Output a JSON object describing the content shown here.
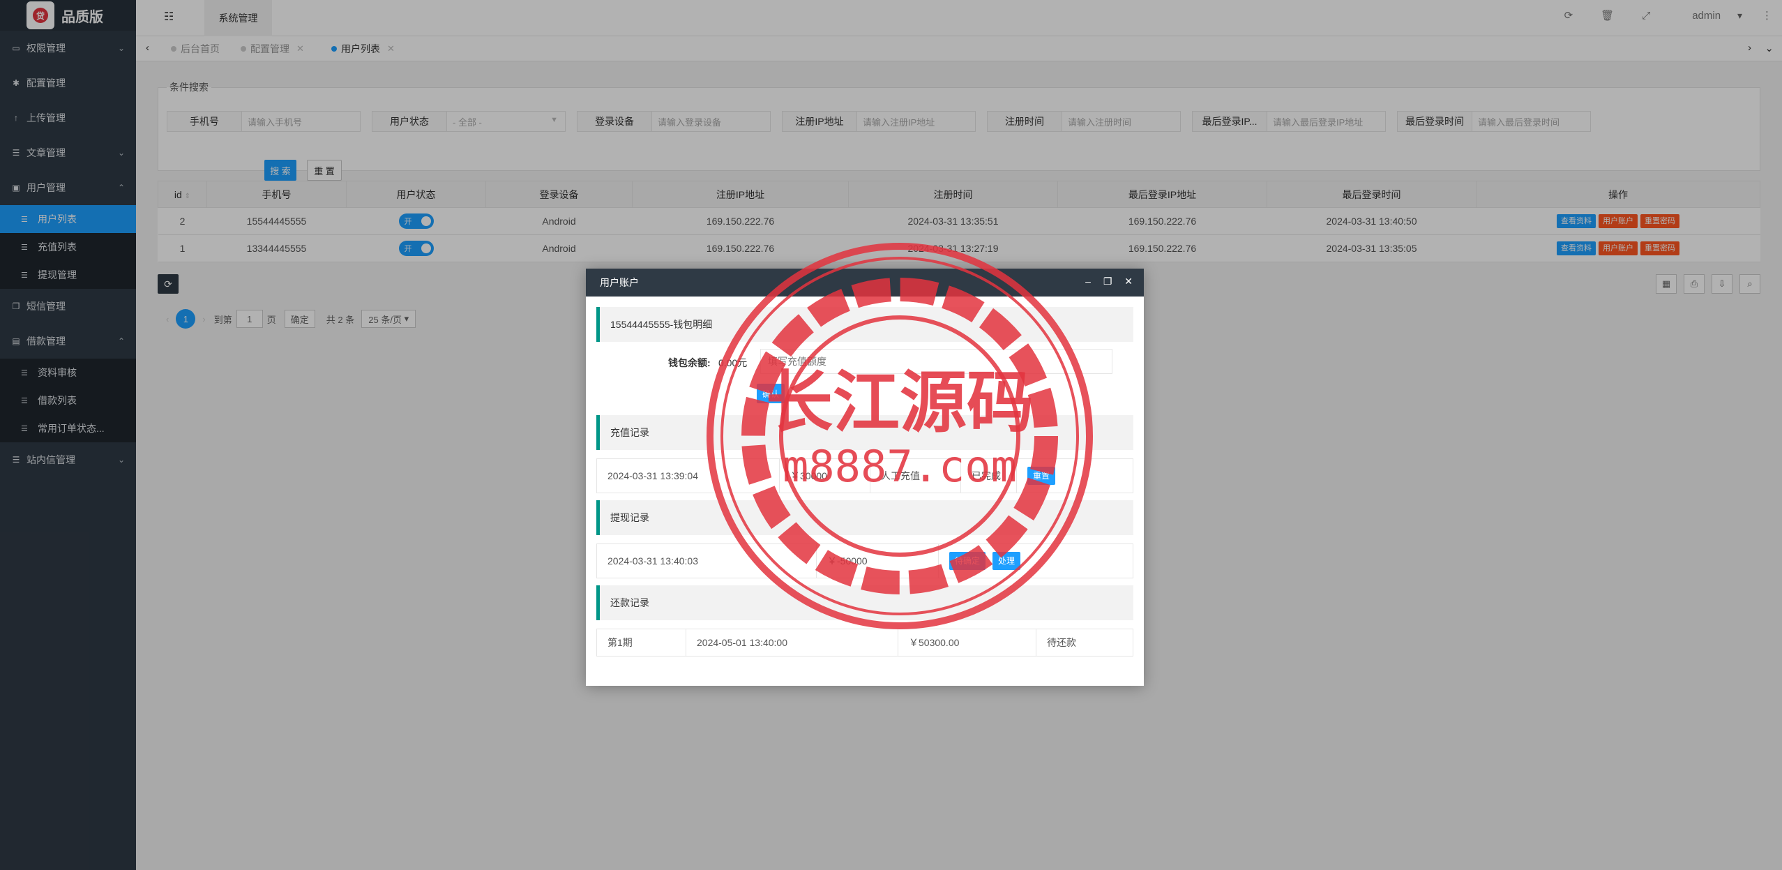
{
  "brand": {
    "logo_glyph": "贷",
    "title": "品质版"
  },
  "sidebar": {
    "items": [
      {
        "label": "权限管理",
        "icon": "laptop-icon"
      },
      {
        "label": "配置管理",
        "icon": "gear-icon"
      },
      {
        "label": "上传管理",
        "icon": "upload-icon"
      },
      {
        "label": "文章管理",
        "icon": "list-icon"
      },
      {
        "label": "用户管理",
        "icon": "user-icon"
      },
      {
        "label": "短信管理",
        "icon": "copy-icon"
      },
      {
        "label": "借款管理",
        "icon": "money-icon"
      },
      {
        "label": "站内信管理",
        "icon": "list-icon"
      }
    ],
    "user_sub": [
      "用户列表",
      "充值列表",
      "提现管理"
    ],
    "loan_sub": [
      "资料审核",
      "借款列表",
      "常用订单状态..."
    ]
  },
  "header": {
    "top_tab": "系统管理",
    "admin": "admin"
  },
  "tabs": [
    {
      "label": "后台首页"
    },
    {
      "label": "配置管理"
    },
    {
      "label": "用户列表"
    }
  ],
  "search": {
    "legend": "条件搜索",
    "fields": [
      {
        "label": "手机号",
        "placeholder": "请输入手机号"
      },
      {
        "label": "用户状态",
        "placeholder": "- 全部 -"
      },
      {
        "label": "登录设备",
        "placeholder": "请输入登录设备"
      },
      {
        "label": "注册IP地址",
        "placeholder": "请输入注册IP地址"
      },
      {
        "label": "注册时间",
        "placeholder": "请输入注册时间"
      },
      {
        "label": "最后登录IP...",
        "placeholder": "请输入最后登录IP地址"
      },
      {
        "label": "最后登录时间",
        "placeholder": "请输入最后登录时间"
      }
    ],
    "search_btn": "搜 索",
    "reset_btn": "重 置"
  },
  "table": {
    "headers": [
      "id",
      "手机号",
      "用户状态",
      "登录设备",
      "注册IP地址",
      "注册时间",
      "最后登录IP地址",
      "最后登录时间",
      "操作"
    ],
    "rows": [
      {
        "id": "2",
        "phone": "15544445555",
        "status": "开",
        "device": "Android",
        "reg_ip": "169.150.222.76",
        "reg_time": "2024-03-31 13:35:51",
        "last_ip": "169.150.222.76",
        "last_time": "2024-03-31 13:40:50"
      },
      {
        "id": "1",
        "phone": "13344445555",
        "status": "开",
        "device": "Android",
        "reg_ip": "169.150.222.76",
        "reg_time": "2024-03-31 13:27:19",
        "last_ip": "169.150.222.76",
        "last_time": "2024-03-31 13:35:05"
      }
    ],
    "ops": [
      "查看资料",
      "用户账户",
      "重置密码"
    ]
  },
  "pager": {
    "page": "1",
    "goto_label": "到第",
    "goto_value": "1",
    "page_unit": "页",
    "confirm": "确定",
    "total": "共 2 条",
    "per_page": "25 条/页"
  },
  "dialog": {
    "title": "用户账户",
    "wallet_section": "15544445555-钱包明细",
    "balance_label": "钱包余额:",
    "balance_value": "0.00元",
    "recharge_placeholder": "填写充值额度",
    "confirm_btn": "确认",
    "recharge_section": "充值记录",
    "recharge_row": {
      "time": "2024-03-31 13:39:04",
      "amount": "￥30000",
      "type": "人工充值",
      "status": "已完成",
      "action": "重置"
    },
    "withdraw_section": "提现记录",
    "withdraw_row": {
      "time": "2024-03-31 13:40:03",
      "amount": "￥-50000",
      "action1": "待确定",
      "action2": "处理"
    },
    "repay_section": "还款记录",
    "repay_row": {
      "period": "第1期",
      "time": "2024-05-01 13:40:00",
      "amount": "￥50300.00",
      "status": "待还款"
    }
  },
  "watermark": {
    "line1": "长江源码",
    "line2": "m8887.com"
  },
  "colors": {
    "accent": "#1e9fff",
    "sidebar": "#2f3a45",
    "danger": "#ff5722",
    "teal": "#009688",
    "seal": "#e3343f"
  }
}
